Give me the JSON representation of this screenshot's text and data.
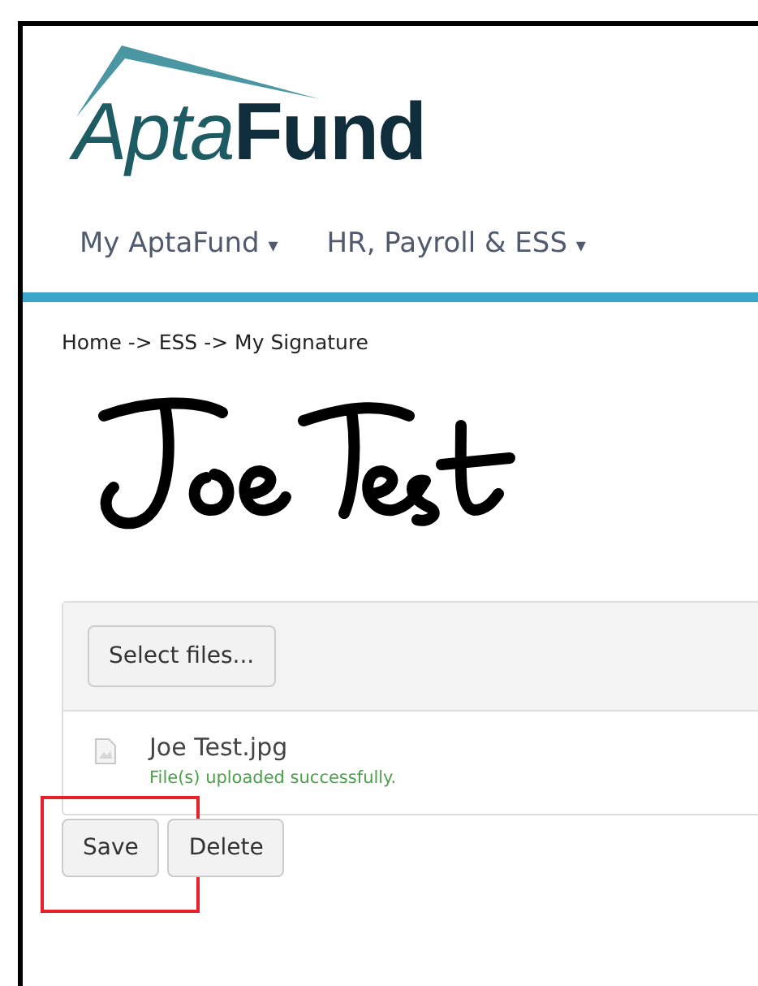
{
  "logo": {
    "light_part": "Apta",
    "bold_part": "Fund"
  },
  "nav": [
    {
      "label": "My AptaFund",
      "caret": "▾"
    },
    {
      "label": "HR, Payroll & ESS",
      "caret": "▾"
    }
  ],
  "breadcrumb": "Home -> ESS -> My Signature",
  "upload": {
    "select_button": "Select files...",
    "files": [
      {
        "name": "Joe Test.jpg",
        "status": "File(s) uploaded successfully."
      }
    ]
  },
  "buttons": [
    {
      "label": "Save",
      "highlighted": true
    },
    {
      "label": "Delete",
      "highlighted": false
    }
  ]
}
